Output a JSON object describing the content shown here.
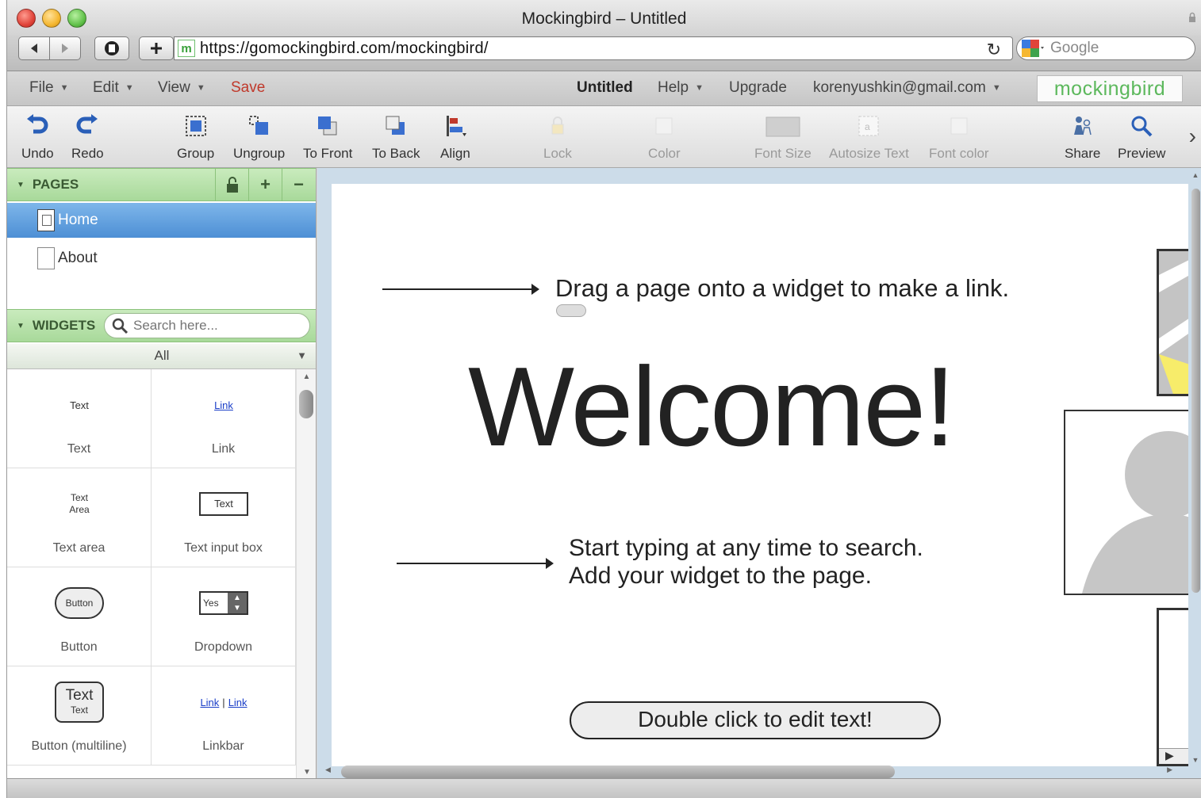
{
  "window": {
    "title": "Mockingbird – Untitled"
  },
  "browser": {
    "url": "https://gomockingbird.com/mockingbird/",
    "site_icon": "m",
    "search_engine": "Google"
  },
  "menubar": {
    "file": "File",
    "edit": "Edit",
    "view": "View",
    "save": "Save",
    "doc_title": "Untitled",
    "help": "Help",
    "upgrade": "Upgrade",
    "account": "korenyushkin@gmail.com",
    "brand": "mockingbird"
  },
  "toolbar": {
    "undo": "Undo",
    "redo": "Redo",
    "group": "Group",
    "ungroup": "Ungroup",
    "to_front": "To Front",
    "to_back": "To Back",
    "align": "Align",
    "lock": "Lock",
    "color": "Color",
    "font_size": "Font Size",
    "autosize_text": "Autosize Text",
    "font_color": "Font color",
    "share": "Share",
    "preview": "Preview"
  },
  "sidebar": {
    "pages_header": "PAGES",
    "pages": [
      {
        "label": "Home"
      },
      {
        "label": "About"
      }
    ],
    "widgets_header": "WIDGETS",
    "search_placeholder": "Search here...",
    "filter": "All",
    "widgets": [
      {
        "label": "Text",
        "preview": "Text"
      },
      {
        "label": "Link",
        "preview": "Link"
      },
      {
        "label": "Text area",
        "preview_line1": "Text",
        "preview_line2": "Area"
      },
      {
        "label": "Text input box",
        "preview": "Text"
      },
      {
        "label": "Button",
        "preview": "Button"
      },
      {
        "label": "Dropdown",
        "preview": "Yes"
      },
      {
        "label": "Button (multiline)",
        "preview_line1": "Text",
        "preview_line2": "Text"
      },
      {
        "label": "Linkbar",
        "preview_line1": "Link",
        "preview_line2": "Link"
      }
    ]
  },
  "canvas": {
    "hint_drag": "Drag a page onto a widget to make a link.",
    "welcome": "Welcome!",
    "hint_search_line1": "Start typing at any time to search.",
    "hint_search_line2": "Add your widget to the page.",
    "edit_button": "Double click to edit text!"
  },
  "icons": {
    "brand_color": "#5cb85c",
    "save_color": "#c0392b",
    "selection_color": "#4d8fd5",
    "section_color": "#a8d99a"
  }
}
